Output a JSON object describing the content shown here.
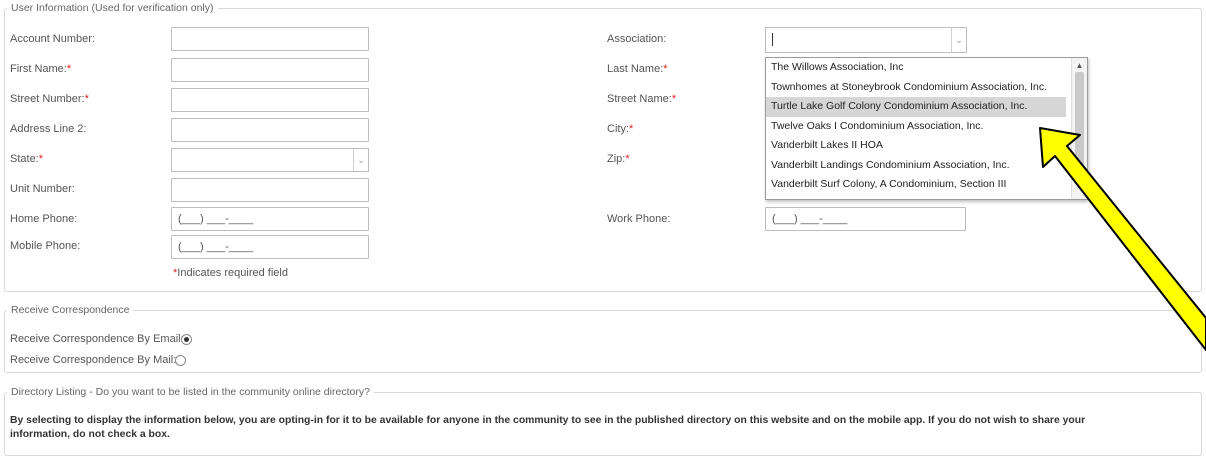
{
  "user_info": {
    "legend": "User Information (Used for verification only)",
    "account_number_label": "Account Number:",
    "first_name_label": "First Name:",
    "street_number_label": "Street Number:",
    "address_line2_label": "Address Line 2:",
    "state_label": "State:",
    "unit_number_label": "Unit Number:",
    "home_phone_label": "Home Phone:",
    "mobile_phone_label": "Mobile Phone:",
    "association_label": "Association:",
    "last_name_label": "Last Name:",
    "street_name_label": "Street Name:",
    "city_label": "City:",
    "zip_label": "Zip:",
    "work_phone_label": "Work Phone:",
    "required_star": "*",
    "required_note": "Indicates required field",
    "phone_mask": "(___) ___-____"
  },
  "association_dropdown": {
    "options": [
      "The Willows Association, Inc",
      "Townhomes at Stoneybrook Condominium Association, Inc.",
      "Turtle Lake Golf Colony Condominium Association, Inc.",
      "Twelve Oaks I Condominium Association, Inc.",
      "Vanderbilt Lakes II HOA",
      "Vanderbilt Landings Condominium Association, Inc.",
      "Vanderbilt Surf Colony, A Condominium, Section III"
    ],
    "highlighted": "Turtle Lake Golf Colony Condominium Association, Inc."
  },
  "correspondence": {
    "legend": "Receive Correspondence",
    "by_email_label": "Receive Correspondence By Email:",
    "by_mail_label": "Receive Correspondence By Mail:"
  },
  "directory": {
    "legend": "Directory Listing - Do you want to be listed in the community online directory?",
    "notice_line1": "By selecting to display the information below, you are opting-in for it to be available for anyone in the community to see in the published directory on this website and on the mobile app. If you do not wish to share your",
    "notice_line2": "information, do not check a box."
  },
  "colors": {
    "annotation_arrow_fill": "#ffff00",
    "annotation_arrow_stroke": "#000000",
    "required": "#e02020",
    "highlight": "#d6d6d6"
  },
  "icons": {
    "select_arrow": "chevron-down-icon",
    "scroll_up": "triangle-up-icon"
  }
}
